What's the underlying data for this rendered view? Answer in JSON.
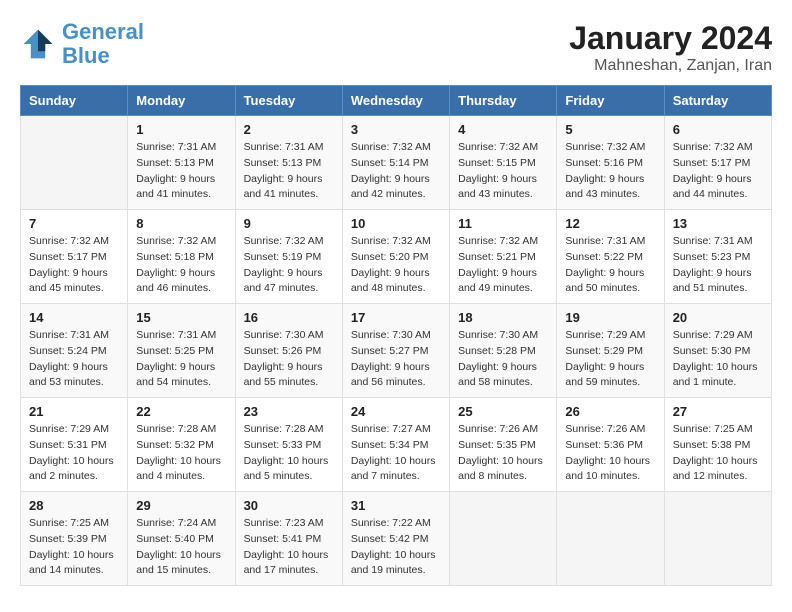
{
  "header": {
    "logo": {
      "line1": "General",
      "line2": "Blue"
    },
    "title": "January 2024",
    "subtitle": "Mahneshan, Zanjan, Iran"
  },
  "weekdays": [
    "Sunday",
    "Monday",
    "Tuesday",
    "Wednesday",
    "Thursday",
    "Friday",
    "Saturday"
  ],
  "weeks": [
    [
      {
        "day": "",
        "sunrise": "",
        "sunset": "",
        "daylight": ""
      },
      {
        "day": "1",
        "sunrise": "Sunrise: 7:31 AM",
        "sunset": "Sunset: 5:13 PM",
        "daylight": "Daylight: 9 hours and 41 minutes."
      },
      {
        "day": "2",
        "sunrise": "Sunrise: 7:31 AM",
        "sunset": "Sunset: 5:13 PM",
        "daylight": "Daylight: 9 hours and 41 minutes."
      },
      {
        "day": "3",
        "sunrise": "Sunrise: 7:32 AM",
        "sunset": "Sunset: 5:14 PM",
        "daylight": "Daylight: 9 hours and 42 minutes."
      },
      {
        "day": "4",
        "sunrise": "Sunrise: 7:32 AM",
        "sunset": "Sunset: 5:15 PM",
        "daylight": "Daylight: 9 hours and 43 minutes."
      },
      {
        "day": "5",
        "sunrise": "Sunrise: 7:32 AM",
        "sunset": "Sunset: 5:16 PM",
        "daylight": "Daylight: 9 hours and 43 minutes."
      },
      {
        "day": "6",
        "sunrise": "Sunrise: 7:32 AM",
        "sunset": "Sunset: 5:17 PM",
        "daylight": "Daylight: 9 hours and 44 minutes."
      }
    ],
    [
      {
        "day": "7",
        "sunrise": "Sunrise: 7:32 AM",
        "sunset": "Sunset: 5:17 PM",
        "daylight": "Daylight: 9 hours and 45 minutes."
      },
      {
        "day": "8",
        "sunrise": "Sunrise: 7:32 AM",
        "sunset": "Sunset: 5:18 PM",
        "daylight": "Daylight: 9 hours and 46 minutes."
      },
      {
        "day": "9",
        "sunrise": "Sunrise: 7:32 AM",
        "sunset": "Sunset: 5:19 PM",
        "daylight": "Daylight: 9 hours and 47 minutes."
      },
      {
        "day": "10",
        "sunrise": "Sunrise: 7:32 AM",
        "sunset": "Sunset: 5:20 PM",
        "daylight": "Daylight: 9 hours and 48 minutes."
      },
      {
        "day": "11",
        "sunrise": "Sunrise: 7:32 AM",
        "sunset": "Sunset: 5:21 PM",
        "daylight": "Daylight: 9 hours and 49 minutes."
      },
      {
        "day": "12",
        "sunrise": "Sunrise: 7:31 AM",
        "sunset": "Sunset: 5:22 PM",
        "daylight": "Daylight: 9 hours and 50 minutes."
      },
      {
        "day": "13",
        "sunrise": "Sunrise: 7:31 AM",
        "sunset": "Sunset: 5:23 PM",
        "daylight": "Daylight: 9 hours and 51 minutes."
      }
    ],
    [
      {
        "day": "14",
        "sunrise": "Sunrise: 7:31 AM",
        "sunset": "Sunset: 5:24 PM",
        "daylight": "Daylight: 9 hours and 53 minutes."
      },
      {
        "day": "15",
        "sunrise": "Sunrise: 7:31 AM",
        "sunset": "Sunset: 5:25 PM",
        "daylight": "Daylight: 9 hours and 54 minutes."
      },
      {
        "day": "16",
        "sunrise": "Sunrise: 7:30 AM",
        "sunset": "Sunset: 5:26 PM",
        "daylight": "Daylight: 9 hours and 55 minutes."
      },
      {
        "day": "17",
        "sunrise": "Sunrise: 7:30 AM",
        "sunset": "Sunset: 5:27 PM",
        "daylight": "Daylight: 9 hours and 56 minutes."
      },
      {
        "day": "18",
        "sunrise": "Sunrise: 7:30 AM",
        "sunset": "Sunset: 5:28 PM",
        "daylight": "Daylight: 9 hours and 58 minutes."
      },
      {
        "day": "19",
        "sunrise": "Sunrise: 7:29 AM",
        "sunset": "Sunset: 5:29 PM",
        "daylight": "Daylight: 9 hours and 59 minutes."
      },
      {
        "day": "20",
        "sunrise": "Sunrise: 7:29 AM",
        "sunset": "Sunset: 5:30 PM",
        "daylight": "Daylight: 10 hours and 1 minute."
      }
    ],
    [
      {
        "day": "21",
        "sunrise": "Sunrise: 7:29 AM",
        "sunset": "Sunset: 5:31 PM",
        "daylight": "Daylight: 10 hours and 2 minutes."
      },
      {
        "day": "22",
        "sunrise": "Sunrise: 7:28 AM",
        "sunset": "Sunset: 5:32 PM",
        "daylight": "Daylight: 10 hours and 4 minutes."
      },
      {
        "day": "23",
        "sunrise": "Sunrise: 7:28 AM",
        "sunset": "Sunset: 5:33 PM",
        "daylight": "Daylight: 10 hours and 5 minutes."
      },
      {
        "day": "24",
        "sunrise": "Sunrise: 7:27 AM",
        "sunset": "Sunset: 5:34 PM",
        "daylight": "Daylight: 10 hours and 7 minutes."
      },
      {
        "day": "25",
        "sunrise": "Sunrise: 7:26 AM",
        "sunset": "Sunset: 5:35 PM",
        "daylight": "Daylight: 10 hours and 8 minutes."
      },
      {
        "day": "26",
        "sunrise": "Sunrise: 7:26 AM",
        "sunset": "Sunset: 5:36 PM",
        "daylight": "Daylight: 10 hours and 10 minutes."
      },
      {
        "day": "27",
        "sunrise": "Sunrise: 7:25 AM",
        "sunset": "Sunset: 5:38 PM",
        "daylight": "Daylight: 10 hours and 12 minutes."
      }
    ],
    [
      {
        "day": "28",
        "sunrise": "Sunrise: 7:25 AM",
        "sunset": "Sunset: 5:39 PM",
        "daylight": "Daylight: 10 hours and 14 minutes."
      },
      {
        "day": "29",
        "sunrise": "Sunrise: 7:24 AM",
        "sunset": "Sunset: 5:40 PM",
        "daylight": "Daylight: 10 hours and 15 minutes."
      },
      {
        "day": "30",
        "sunrise": "Sunrise: 7:23 AM",
        "sunset": "Sunset: 5:41 PM",
        "daylight": "Daylight: 10 hours and 17 minutes."
      },
      {
        "day": "31",
        "sunrise": "Sunrise: 7:22 AM",
        "sunset": "Sunset: 5:42 PM",
        "daylight": "Daylight: 10 hours and 19 minutes."
      },
      {
        "day": "",
        "sunrise": "",
        "sunset": "",
        "daylight": ""
      },
      {
        "day": "",
        "sunrise": "",
        "sunset": "",
        "daylight": ""
      },
      {
        "day": "",
        "sunrise": "",
        "sunset": "",
        "daylight": ""
      }
    ]
  ]
}
